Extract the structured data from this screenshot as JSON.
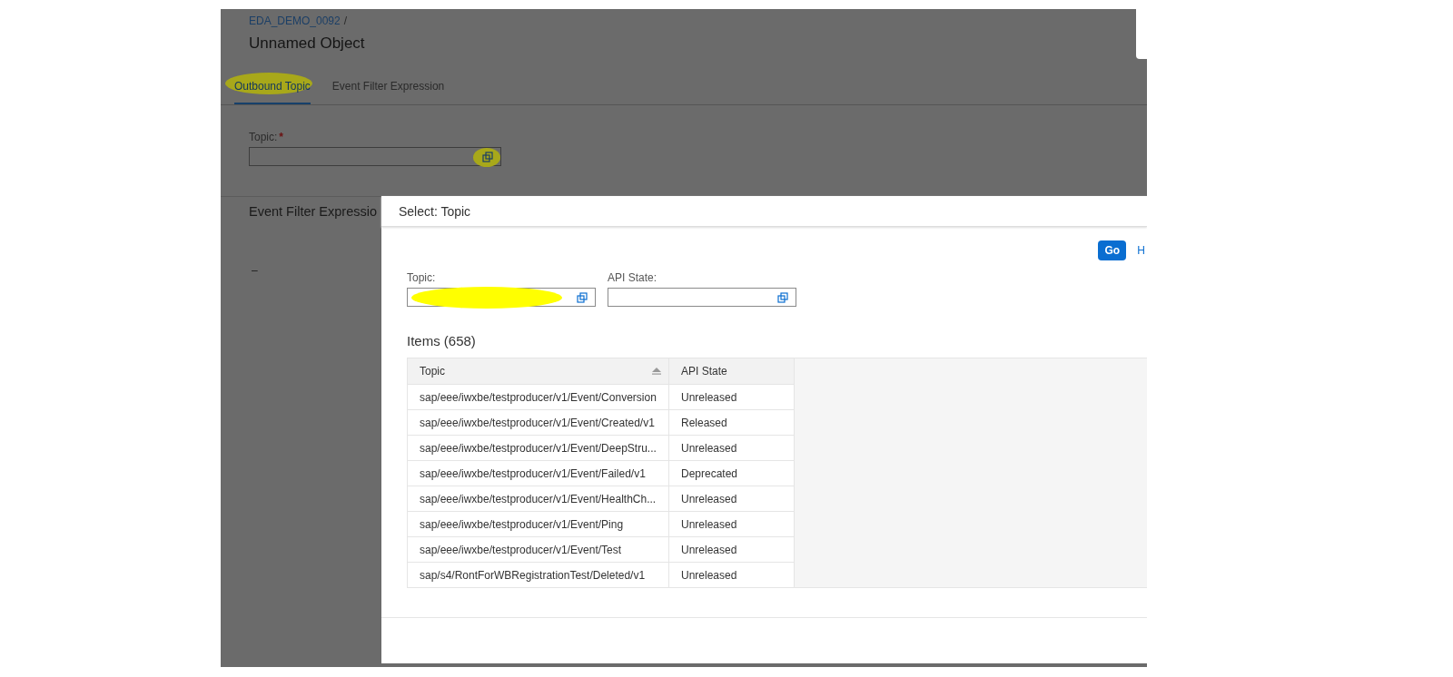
{
  "page": {
    "breadcrumb": "EDA_DEMO_0092",
    "breadcrumb_separator": "/",
    "title": "Unnamed Object",
    "tabs": [
      {
        "label": "Outbound Topic",
        "selected": true
      },
      {
        "label": "Event Filter Expression",
        "selected": false
      }
    ],
    "topic_field": {
      "label": "Topic:",
      "required_mark": "*"
    },
    "section_title": "Event Filter Expressio",
    "section_value": "–"
  },
  "dialog": {
    "title": "Select: Topic",
    "go_button": "Go",
    "hide_filter_link": "H",
    "filters": [
      {
        "label": "Topic:"
      },
      {
        "label": "API State:"
      }
    ],
    "items_title": "Items (658)",
    "table": {
      "columns": [
        {
          "label": "Topic",
          "sorted": true
        },
        {
          "label": "API State",
          "sorted": false
        }
      ],
      "rows": [
        [
          "sap/eee/iwxbe/testproducer/v1/Event/Conversion",
          "Unreleased"
        ],
        [
          "sap/eee/iwxbe/testproducer/v1/Event/Created/v1",
          "Released"
        ],
        [
          "sap/eee/iwxbe/testproducer/v1/Event/DeepStru...",
          "Unreleased"
        ],
        [
          "sap/eee/iwxbe/testproducer/v1/Event/Failed/v1",
          "Deprecated"
        ],
        [
          "sap/eee/iwxbe/testproducer/v1/Event/HealthCh...",
          "Unreleased"
        ],
        [
          "sap/eee/iwxbe/testproducer/v1/Event/Ping",
          "Unreleased"
        ],
        [
          "sap/eee/iwxbe/testproducer/v1/Event/Test",
          "Unreleased"
        ],
        [
          "sap/s4/RontForWBRegistrationTest/Deleted/v1",
          "Unreleased"
        ]
      ]
    }
  }
}
